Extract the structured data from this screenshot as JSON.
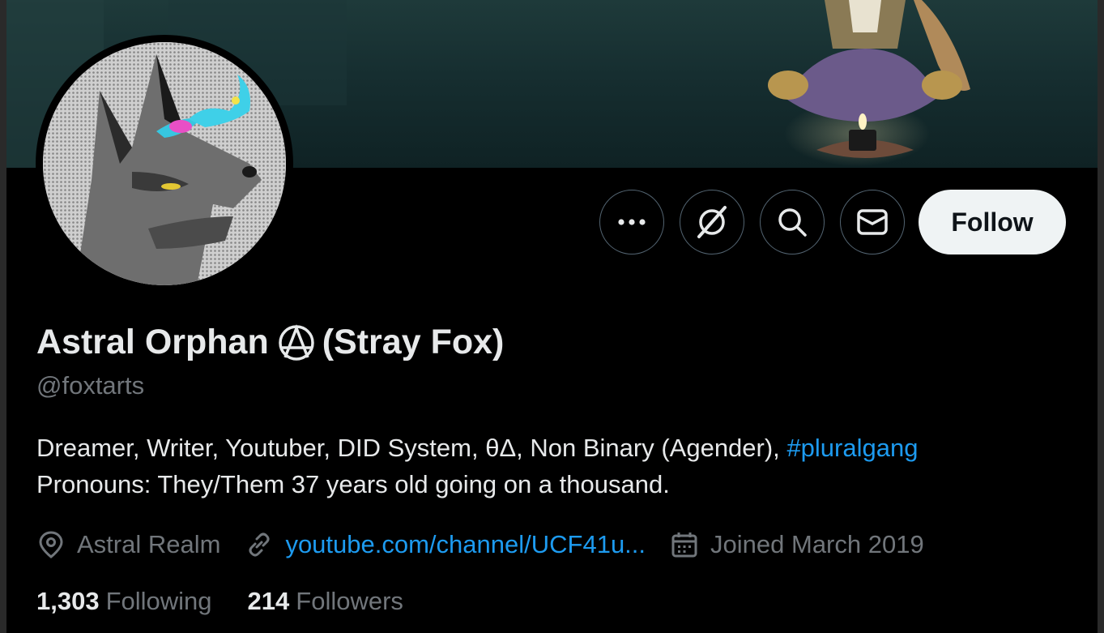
{
  "profile": {
    "name": "Astral Orphan",
    "name_suffix": "(Stray Fox)",
    "handle": "@foxtarts",
    "bio_text": "Dreamer, Writer, Youtuber, DID System, θΔ, Non Binary (Agender),",
    "bio_hashtag": "#pluralgang",
    "bio_line2": "Pronouns: They/Them 37 years old going on a thousand.",
    "location": "Astral Realm",
    "website": "youtube.com/channel/UCF41u...",
    "joined": "Joined March 2019",
    "following_count": "1,303",
    "following_label": "Following",
    "followers_count": "214",
    "followers_label": "Followers"
  },
  "actions": {
    "follow_label": "Follow",
    "more_icon": "more-horizontal-icon",
    "grok_icon": "grok-icon",
    "search_icon": "search-icon",
    "message_icon": "envelope-icon"
  },
  "colors": {
    "background": "#000000",
    "text_primary": "#e7e9ea",
    "text_secondary": "#71767b",
    "link": "#1d9bf0",
    "follow_bg": "#eff3f4",
    "border": "#536471"
  }
}
